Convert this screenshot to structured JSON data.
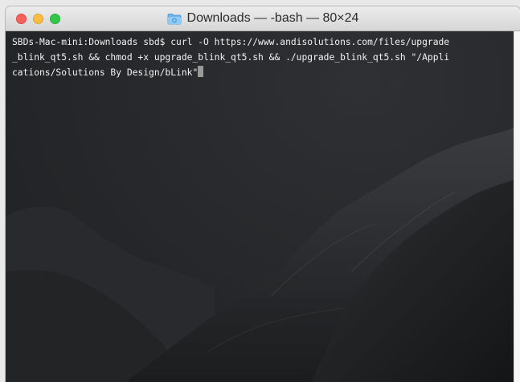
{
  "window": {
    "title": "Downloads — -bash — 80×24",
    "folder_icon": "folder-icon",
    "traffic_lights": {
      "close": "#fc605c",
      "minimize": "#fdbc40",
      "zoom": "#34c84a"
    }
  },
  "terminal": {
    "lines": [
      "SBDs-Mac-mini:Downloads sbd$ curl -O https://www.andisolutions.com/files/upgrade",
      "_blink_qt5.sh && chmod +x upgrade_blink_qt5.sh && ./upgrade_blink_qt5.sh \"/Appli",
      "cations/Solutions By Design/bLink\""
    ],
    "text_color": "#f2f2f2",
    "background_theme": "dark-mountain-wallpaper"
  }
}
